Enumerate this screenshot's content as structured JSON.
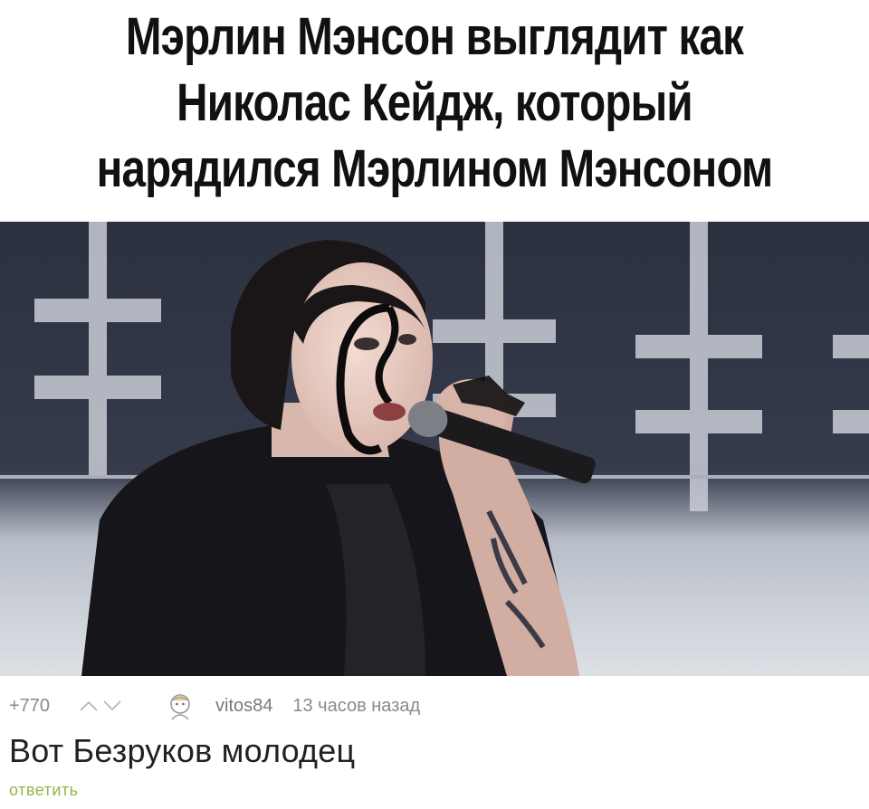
{
  "meme": {
    "title_lines": [
      "Мэрлин Мэнсон выглядит как",
      "Николас Кейдж, который",
      "нарядился Мэрлином Мэнсоном"
    ]
  },
  "comment": {
    "rating": "+770",
    "username": "vitos84",
    "time": "13 часов назад",
    "text": "Вот Безруков молодец",
    "reply_label": "ответить"
  },
  "icons": {
    "upvote": "upvote-arrow-icon",
    "downvote": "downvote-arrow-icon",
    "avatar": "user-avatar-icon"
  },
  "colors": {
    "reply": "#8fb84a",
    "meta": "#8a8a8a",
    "title": "#111111"
  }
}
